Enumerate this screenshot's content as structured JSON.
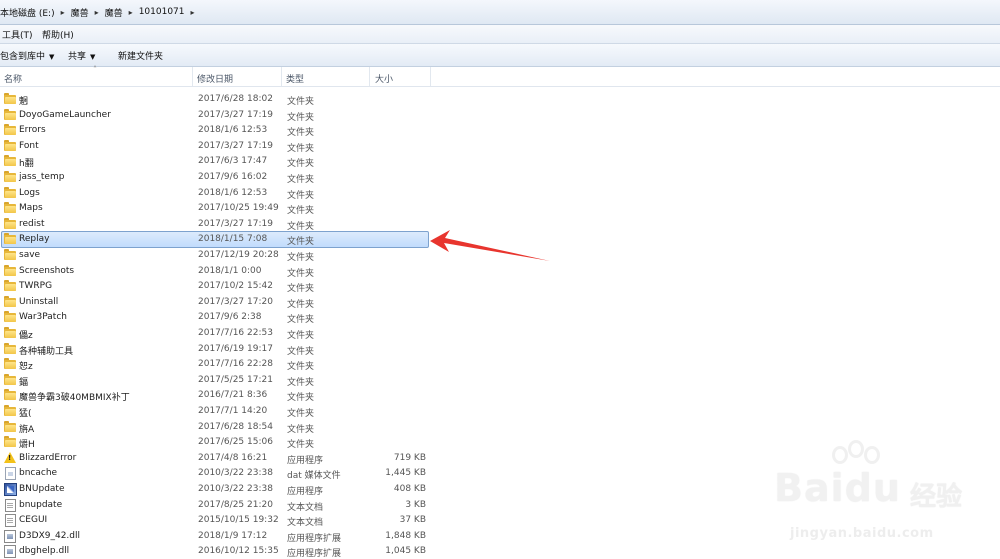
{
  "breadcrumb": [
    "本地磁盘 (E:)",
    "魔兽",
    "魔兽",
    "10101071"
  ],
  "menu": [
    "工具(T)",
    "帮助(H)"
  ],
  "toolbar": {
    "include_label": "包含到库中",
    "share_label": "共享",
    "new_folder_label": "新建文件夹"
  },
  "columns": {
    "name": "名称",
    "date": "修改日期",
    "type": "类型",
    "size": "大小"
  },
  "selected_item": "Replay",
  "rows": [
    {
      "name": "魍",
      "date": "2017/6/28 18:02",
      "type": "文件夹",
      "size": "",
      "icon": "folder"
    },
    {
      "name": "DoyoGameLauncher",
      "date": "2017/3/27 17:19",
      "type": "文件夹",
      "size": "",
      "icon": "folder"
    },
    {
      "name": "Errors",
      "date": "2018/1/6 12:53",
      "type": "文件夹",
      "size": "",
      "icon": "folder"
    },
    {
      "name": "Font",
      "date": "2017/3/27 17:19",
      "type": "文件夹",
      "size": "",
      "icon": "folder"
    },
    {
      "name": "h翻",
      "date": "2017/6/3 17:47",
      "type": "文件夹",
      "size": "",
      "icon": "folder"
    },
    {
      "name": "jass_temp",
      "date": "2017/9/6 16:02",
      "type": "文件夹",
      "size": "",
      "icon": "folder"
    },
    {
      "name": "Logs",
      "date": "2018/1/6 12:53",
      "type": "文件夹",
      "size": "",
      "icon": "folder"
    },
    {
      "name": "Maps",
      "date": "2017/10/25 19:49",
      "type": "文件夹",
      "size": "",
      "icon": "folder"
    },
    {
      "name": "redist",
      "date": "2017/3/27 17:19",
      "type": "文件夹",
      "size": "",
      "icon": "folder"
    },
    {
      "name": "Replay",
      "date": "2018/1/15 7:08",
      "type": "文件夹",
      "size": "",
      "icon": "folder"
    },
    {
      "name": "save",
      "date": "2017/12/19 20:28",
      "type": "文件夹",
      "size": "",
      "icon": "folder"
    },
    {
      "name": "Screenshots",
      "date": "2018/1/1 0:00",
      "type": "文件夹",
      "size": "",
      "icon": "folder"
    },
    {
      "name": "TWRPG",
      "date": "2017/10/2 15:42",
      "type": "文件夹",
      "size": "",
      "icon": "folder"
    },
    {
      "name": "Uninstall",
      "date": "2017/3/27 17:20",
      "type": "文件夹",
      "size": "",
      "icon": "folder"
    },
    {
      "name": "War3Patch",
      "date": "2017/9/6 2:38",
      "type": "文件夹",
      "size": "",
      "icon": "folder"
    },
    {
      "name": "儡z",
      "date": "2017/7/16 22:53",
      "type": "文件夹",
      "size": "",
      "icon": "folder"
    },
    {
      "name": "各种辅助工具",
      "date": "2017/6/19 19:17",
      "type": "文件夹",
      "size": "",
      "icon": "folder"
    },
    {
      "name": "恕z",
      "date": "2017/7/16 22:28",
      "type": "文件夹",
      "size": "",
      "icon": "folder"
    },
    {
      "name": "鍢",
      "date": "2017/5/25 17:21",
      "type": "文件夹",
      "size": "",
      "icon": "folder"
    },
    {
      "name": "魔兽争霸3破40MBMIX补丁",
      "date": "2016/7/21 8:36",
      "type": "文件夹",
      "size": "",
      "icon": "folder"
    },
    {
      "name": "猛(",
      "date": "2017/7/1 14:20",
      "type": "文件夹",
      "size": "",
      "icon": "folder"
    },
    {
      "name": "旃A",
      "date": "2017/6/28 18:54",
      "type": "文件夹",
      "size": "",
      "icon": "folder"
    },
    {
      "name": "爝H",
      "date": "2017/6/25 15:06",
      "type": "文件夹",
      "size": "",
      "icon": "folder"
    },
    {
      "name": "BlizzardError",
      "date": "2017/4/8 16:21",
      "type": "应用程序",
      "size": "719 KB",
      "icon": "warning-app"
    },
    {
      "name": "bncache",
      "date": "2010/3/22 23:38",
      "type": "dat 媒体文件",
      "size": "1,445 KB",
      "icon": "dat-file"
    },
    {
      "name": "BNUpdate",
      "date": "2010/3/22 23:38",
      "type": "应用程序",
      "size": "408 KB",
      "icon": "app"
    },
    {
      "name": "bnupdate",
      "date": "2017/8/25 21:20",
      "type": "文本文档",
      "size": "3 KB",
      "icon": "text-file"
    },
    {
      "name": "CEGUI",
      "date": "2015/10/15 19:32",
      "type": "文本文档",
      "size": "37 KB",
      "icon": "text-file"
    },
    {
      "name": "D3DX9_42.dll",
      "date": "2018/1/9 17:12",
      "type": "应用程序扩展",
      "size": "1,848 KB",
      "icon": "dll-file"
    },
    {
      "name": "dbghelp.dll",
      "date": "2016/10/12 15:35",
      "type": "应用程序扩展",
      "size": "1,045 KB",
      "icon": "dll-file"
    }
  ],
  "watermark": {
    "brand": "Baidu",
    "cn": "经验",
    "url": "jingyan.baidu.com"
  },
  "colors": {
    "selection": "#c1dcfc",
    "folder": "#f2c649",
    "arrow": "#e8352e"
  }
}
